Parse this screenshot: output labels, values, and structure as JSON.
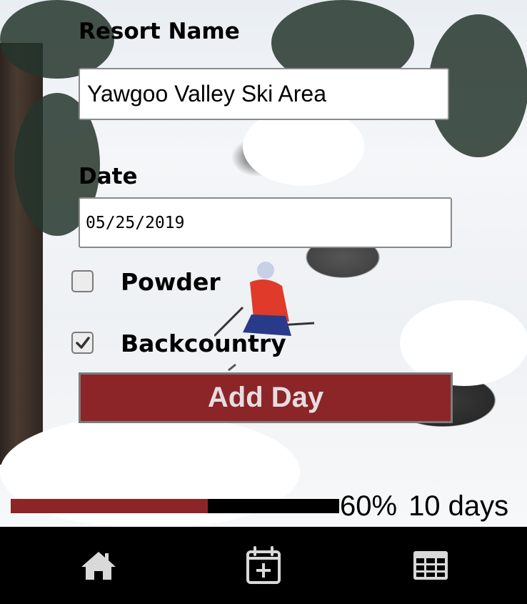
{
  "form": {
    "resort_label": "Resort Name",
    "resort_value": "Yawgoo Valley Ski Area",
    "date_label": "Date",
    "date_value": "05/25/2019",
    "powder_label": "Powder",
    "powder_checked": false,
    "backcountry_label": "Backcountry",
    "backcountry_checked": true,
    "submit_label": "Add Day"
  },
  "progress": {
    "percent_text": "60%",
    "days_text": "10 days",
    "fraction": 0.6,
    "fill_color": "#8b2528"
  },
  "nav": {
    "items": [
      {
        "icon": "home-icon"
      },
      {
        "icon": "calendar-add-icon"
      },
      {
        "icon": "table-icon"
      }
    ]
  },
  "colors": {
    "accent": "#8b2528",
    "nav_bg": "#000000"
  }
}
